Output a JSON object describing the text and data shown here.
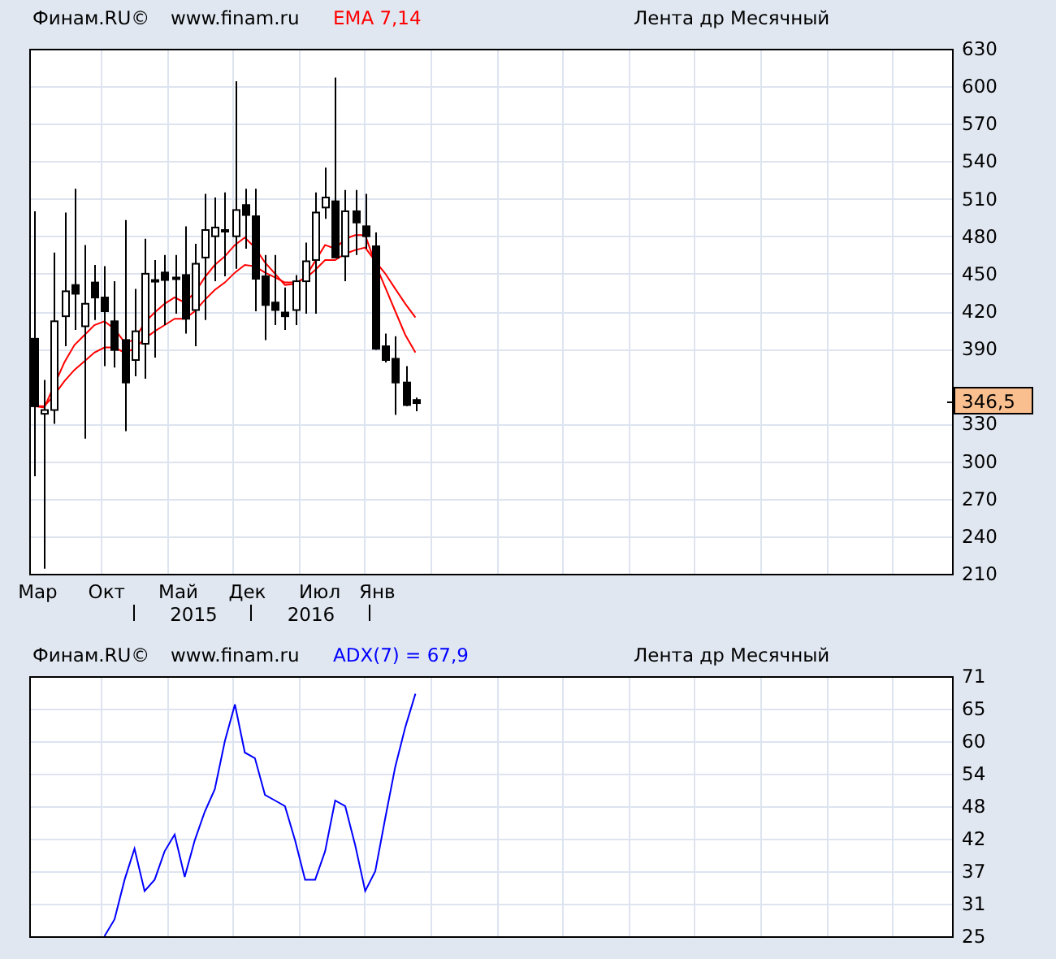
{
  "price_panel": {
    "header": [
      {
        "kind": "source",
        "text": "Финам.RU©"
      },
      {
        "kind": "link",
        "text": "www.finam.ru"
      },
      {
        "kind": "indicator",
        "text": "EMA 7,14"
      },
      {
        "kind": "title",
        "text": "Лента др Месячный"
      }
    ],
    "price_tag": "346,5",
    "chart_data": {
      "type": "candlestick",
      "categories": [
        "Мар",
        null,
        null,
        null,
        null,
        null,
        null,
        "Окт",
        null,
        null,
        null,
        null,
        null,
        null,
        "Май",
        null,
        null,
        null,
        null,
        null,
        null,
        "Дек",
        null,
        null,
        null,
        null,
        null,
        null,
        "Июл",
        null,
        null,
        null,
        null,
        null,
        "Янв",
        null,
        null,
        null,
        null,
        null,
        null,
        null,
        null,
        null,
        null,
        null,
        null,
        null,
        null,
        null,
        null,
        null,
        null,
        null,
        null,
        null,
        null,
        null,
        null,
        null,
        null,
        null,
        null,
        null,
        null,
        null,
        null,
        null,
        null,
        null,
        null,
        null,
        null,
        null,
        null,
        null,
        null,
        null,
        null,
        null,
        null,
        null,
        null,
        null,
        null,
        null,
        null,
        null,
        null,
        null,
        null,
        null
      ],
      "ohlc": [
        [
          398,
          500,
          288,
          344
        ],
        [
          338,
          365,
          214,
          341
        ],
        [
          341,
          467,
          330,
          412
        ],
        [
          416,
          499,
          392,
          436
        ],
        [
          441,
          518,
          405,
          434
        ],
        [
          408,
          473,
          318,
          426
        ],
        [
          443,
          457,
          413,
          431
        ],
        [
          431,
          456,
          376,
          420
        ],
        [
          412,
          444,
          375,
          389
        ],
        [
          397,
          493,
          324,
          363
        ],
        [
          381,
          438,
          368,
          404
        ],
        [
          394,
          478,
          366,
          450
        ],
        [
          445,
          461,
          383,
          445
        ],
        [
          451,
          465,
          409,
          445
        ],
        [
          447,
          465,
          418,
          447
        ],
        [
          449,
          488,
          402,
          414
        ],
        [
          421,
          474,
          392,
          458
        ],
        [
          463,
          514,
          413,
          485
        ],
        [
          480,
          511,
          444,
          487
        ],
        [
          485,
          515,
          448,
          485
        ],
        [
          480,
          604,
          454,
          501
        ],
        [
          505,
          518,
          470,
          497
        ],
        [
          496,
          518,
          420,
          446
        ],
        [
          448,
          465,
          397,
          425
        ],
        [
          427,
          465,
          409,
          421
        ],
        [
          419,
          439,
          405,
          416
        ],
        [
          421,
          449,
          409,
          444
        ],
        [
          444,
          475,
          418,
          460
        ],
        [
          461,
          515,
          418,
          499
        ],
        [
          503,
          535,
          494,
          511
        ],
        [
          508,
          607,
          463,
          463
        ],
        [
          464,
          517,
          444,
          500
        ],
        [
          500,
          517,
          465,
          491
        ],
        [
          488,
          514,
          470,
          480
        ],
        [
          472,
          483,
          389,
          390
        ],
        [
          392,
          402,
          379,
          381
        ],
        [
          382,
          400,
          337,
          363
        ],
        [
          363,
          376,
          344,
          345
        ],
        [
          349,
          351,
          340,
          346.5
        ],
        null,
        null,
        null,
        null,
        null,
        null,
        null,
        null,
        null,
        null,
        null,
        null,
        null,
        null,
        null,
        null,
        null,
        null,
        null,
        null,
        null,
        null,
        null,
        null,
        null,
        null,
        null,
        null,
        null,
        null,
        null,
        null,
        null,
        null,
        null,
        null,
        null,
        null,
        null,
        null,
        null,
        null,
        null,
        null,
        null,
        null,
        null,
        null,
        null,
        null,
        null,
        null,
        null
      ],
      "series": [
        {
          "type": "line",
          "color": "#ff0000",
          "values": [
            344,
            343,
            361,
            379,
            393,
            401,
            409,
            412,
            406,
            395,
            397,
            411,
            419,
            426,
            431,
            427,
            435,
            447,
            457,
            464,
            473,
            479,
            471,
            459,
            450,
            441,
            442,
            447,
            460,
            473,
            470,
            478,
            481,
            481,
            458,
            439,
            420,
            401,
            387,
            null,
            null,
            null,
            null,
            null,
            null,
            null,
            null,
            null,
            null,
            null,
            null,
            null,
            null,
            null,
            null,
            null,
            null,
            null,
            null,
            null,
            null,
            null,
            null,
            null,
            null,
            null,
            null,
            null,
            null,
            null,
            null,
            null,
            null,
            null,
            null,
            null,
            null,
            null,
            null,
            null,
            null,
            null,
            null,
            null,
            null,
            null,
            null,
            null,
            null,
            null,
            null,
            null
          ]
        },
        {
          "type": "line",
          "color": "#ff0000",
          "values": [
            344,
            344,
            353,
            364,
            373,
            380,
            387,
            391,
            391,
            387,
            390,
            398,
            404,
            409,
            414,
            414,
            420,
            429,
            437,
            443,
            451,
            457,
            456,
            451,
            447,
            443,
            443,
            446,
            453,
            461,
            461,
            466,
            469,
            471,
            460,
            450,
            438,
            426,
            415,
            null,
            null,
            null,
            null,
            null,
            null,
            null,
            null,
            null,
            null,
            null,
            null,
            null,
            null,
            null,
            null,
            null,
            null,
            null,
            null,
            null,
            null,
            null,
            null,
            null,
            null,
            null,
            null,
            null,
            null,
            null,
            null,
            null,
            null,
            null,
            null,
            null,
            null,
            null,
            null,
            null,
            null,
            null,
            null,
            null,
            null,
            null,
            null,
            null,
            null,
            null,
            null,
            null
          ]
        }
      ],
      "ylim": [
        210,
        630
      ],
      "grid": true,
      "yticks": [
        210,
        240,
        270,
        300,
        330,
        390,
        420,
        450,
        480,
        510,
        540,
        570,
        600,
        630
      ],
      "annotations": [
        {
          "text": "2015"
        },
        {
          "text": "2016"
        }
      ]
    }
  },
  "adx_panel": {
    "header": [
      {
        "kind": "source",
        "text": "Финам.RU©"
      },
      {
        "kind": "link",
        "text": "www.finam.ru"
      },
      {
        "kind": "indicator",
        "text": "ADX(7) = 67,9"
      },
      {
        "kind": "title",
        "text": "Лента др Месячный"
      }
    ],
    "chart_data": {
      "type": "line",
      "categories": [
        null,
        null,
        null,
        null,
        null,
        null,
        null,
        null,
        null,
        null,
        null,
        null,
        null,
        null,
        null,
        null,
        null,
        null,
        null,
        null,
        null,
        null,
        null,
        null,
        null,
        null,
        null,
        null,
        null,
        null,
        null,
        null,
        null,
        null,
        null,
        null,
        null,
        null,
        null,
        null,
        null,
        null,
        null,
        null,
        null,
        null,
        null,
        null,
        null,
        null,
        null,
        null,
        null,
        null,
        null,
        null,
        null,
        null,
        null,
        null,
        null,
        null,
        null,
        null,
        null,
        null,
        null,
        null,
        null,
        null,
        null,
        null,
        null,
        null,
        null,
        null,
        null,
        null,
        null,
        null,
        null,
        null,
        null,
        null,
        null,
        null,
        null,
        null,
        null,
        null,
        null,
        null
      ],
      "series": [
        {
          "color": "#0000ff",
          "values": [
            null,
            null,
            null,
            null,
            null,
            null,
            null,
            25,
            28,
            35,
            40.5,
            33,
            35,
            40,
            43,
            35.5,
            42,
            47,
            51,
            59.5,
            66,
            57.5,
            56.5,
            50,
            49,
            48,
            42,
            35,
            35,
            40,
            49,
            48,
            41,
            33,
            36.5,
            46,
            55,
            62,
            67.9,
            null,
            null,
            null,
            null,
            null,
            null,
            null,
            null,
            null,
            null,
            null,
            null,
            null,
            null,
            null,
            null,
            null,
            null,
            null,
            null,
            null,
            null,
            null,
            null,
            null,
            null,
            null,
            null,
            null,
            null,
            null,
            null,
            null,
            null,
            null,
            null,
            null,
            null,
            null,
            null,
            null,
            null,
            null,
            null,
            null,
            null,
            null,
            null,
            null,
            null,
            null,
            null,
            null
          ]
        }
      ],
      "ylim": [
        25,
        71
      ],
      "grid": true,
      "yticks": [
        {
          "value": 25,
          "label": "25"
        },
        {
          "value": 30.75,
          "label": "31"
        },
        {
          "value": 36.5,
          "label": "37"
        },
        {
          "value": 42.25,
          "label": "42"
        },
        {
          "value": 48,
          "label": "48"
        },
        {
          "value": 53.75,
          "label": "54"
        },
        {
          "value": 59.5,
          "label": "60"
        },
        {
          "value": 65.25,
          "label": "65"
        },
        {
          "value": 71,
          "label": "71"
        }
      ]
    }
  }
}
